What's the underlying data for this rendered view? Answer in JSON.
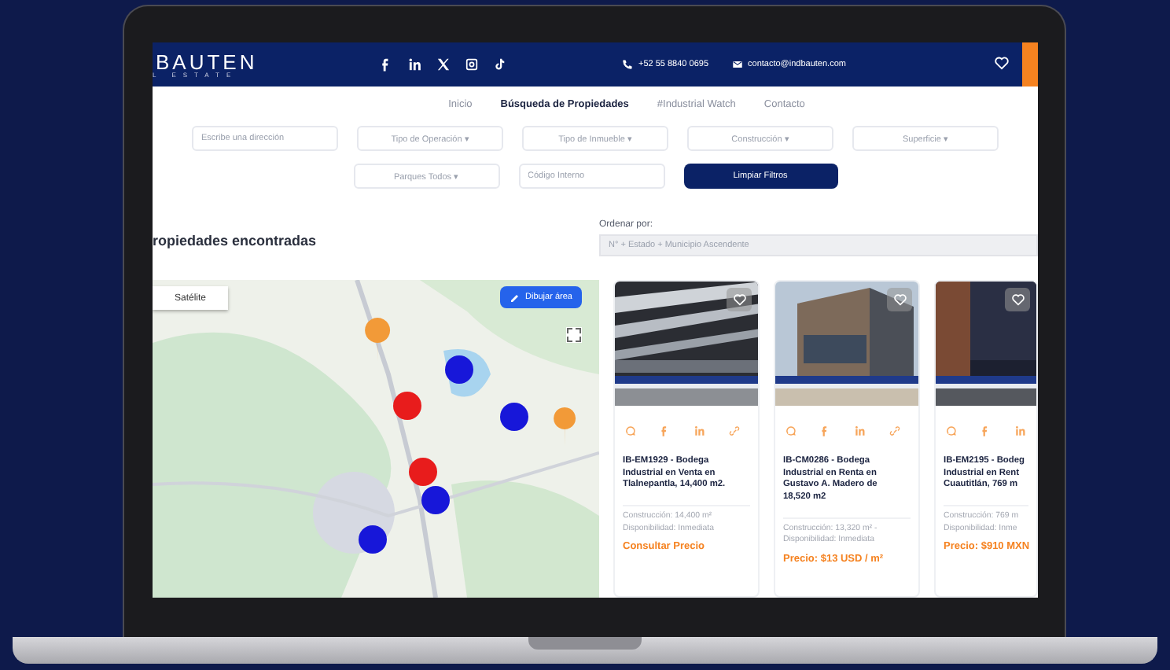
{
  "header": {
    "logo": "BAUTEN",
    "logo_sub": "L ESTATE",
    "phone": "+52 55 8840 0695",
    "email": "contacto@indbauten.com"
  },
  "nav": [
    {
      "label": "Inicio",
      "selected": false
    },
    {
      "label": "Búsqueda de Propiedades",
      "selected": true
    },
    {
      "label": "#Industrial Watch",
      "selected": false
    },
    {
      "label": "Contacto",
      "selected": false
    }
  ],
  "filters": [
    {
      "kind": "input",
      "placeholder": "Escribe una dirección"
    },
    {
      "kind": "select",
      "label": "Tipo de Operación ▾"
    },
    {
      "kind": "select",
      "label": "Tipo de Inmueble ▾"
    },
    {
      "kind": "select",
      "label": "Construcción ▾"
    },
    {
      "kind": "select",
      "label": "Superficie ▾"
    }
  ],
  "filters_row2": [
    {
      "kind": "select",
      "label": "Parques Todos ▾"
    },
    {
      "kind": "input",
      "placeholder": "Código Interno"
    },
    {
      "kind": "button",
      "label": "Limpiar Filtros"
    }
  ],
  "results": {
    "heading": "ropiedades encontradas",
    "sort_label": "Ordenar por:",
    "sort_value": "N° + Estado + Municipio Ascendente"
  },
  "map": {
    "layer_button": "Satélite",
    "draw_button": "Dibujar área"
  },
  "cards": [
    {
      "title_lines": [
        "IB-EM1929 - Bodega",
        "Industrial en Venta en",
        "Tlalnepantla, 14,400 m2."
      ],
      "construction": "Construcción: 14,400 m²",
      "availability": "Disponibilidad: Inmediata",
      "price": "Consultar Precio"
    },
    {
      "title_lines": [
        "IB-CM0286 - Bodega",
        "Industrial en Renta en",
        "Gustavo A. Madero de",
        "18,520 m2"
      ],
      "construction": "Construcción: 13,320 m² -",
      "availability": "Disponibilidad: Inmediata",
      "price": "Precio: $13 USD / m²"
    },
    {
      "title_lines": [
        "IB-EM2195 - Bodeg",
        "Industrial en Rent",
        "Cuautitlán, 769 m"
      ],
      "construction": "Construcción: 769 m",
      "availability": "Disponibilidad: Inme",
      "price": "Precio: $910 MXN"
    }
  ]
}
